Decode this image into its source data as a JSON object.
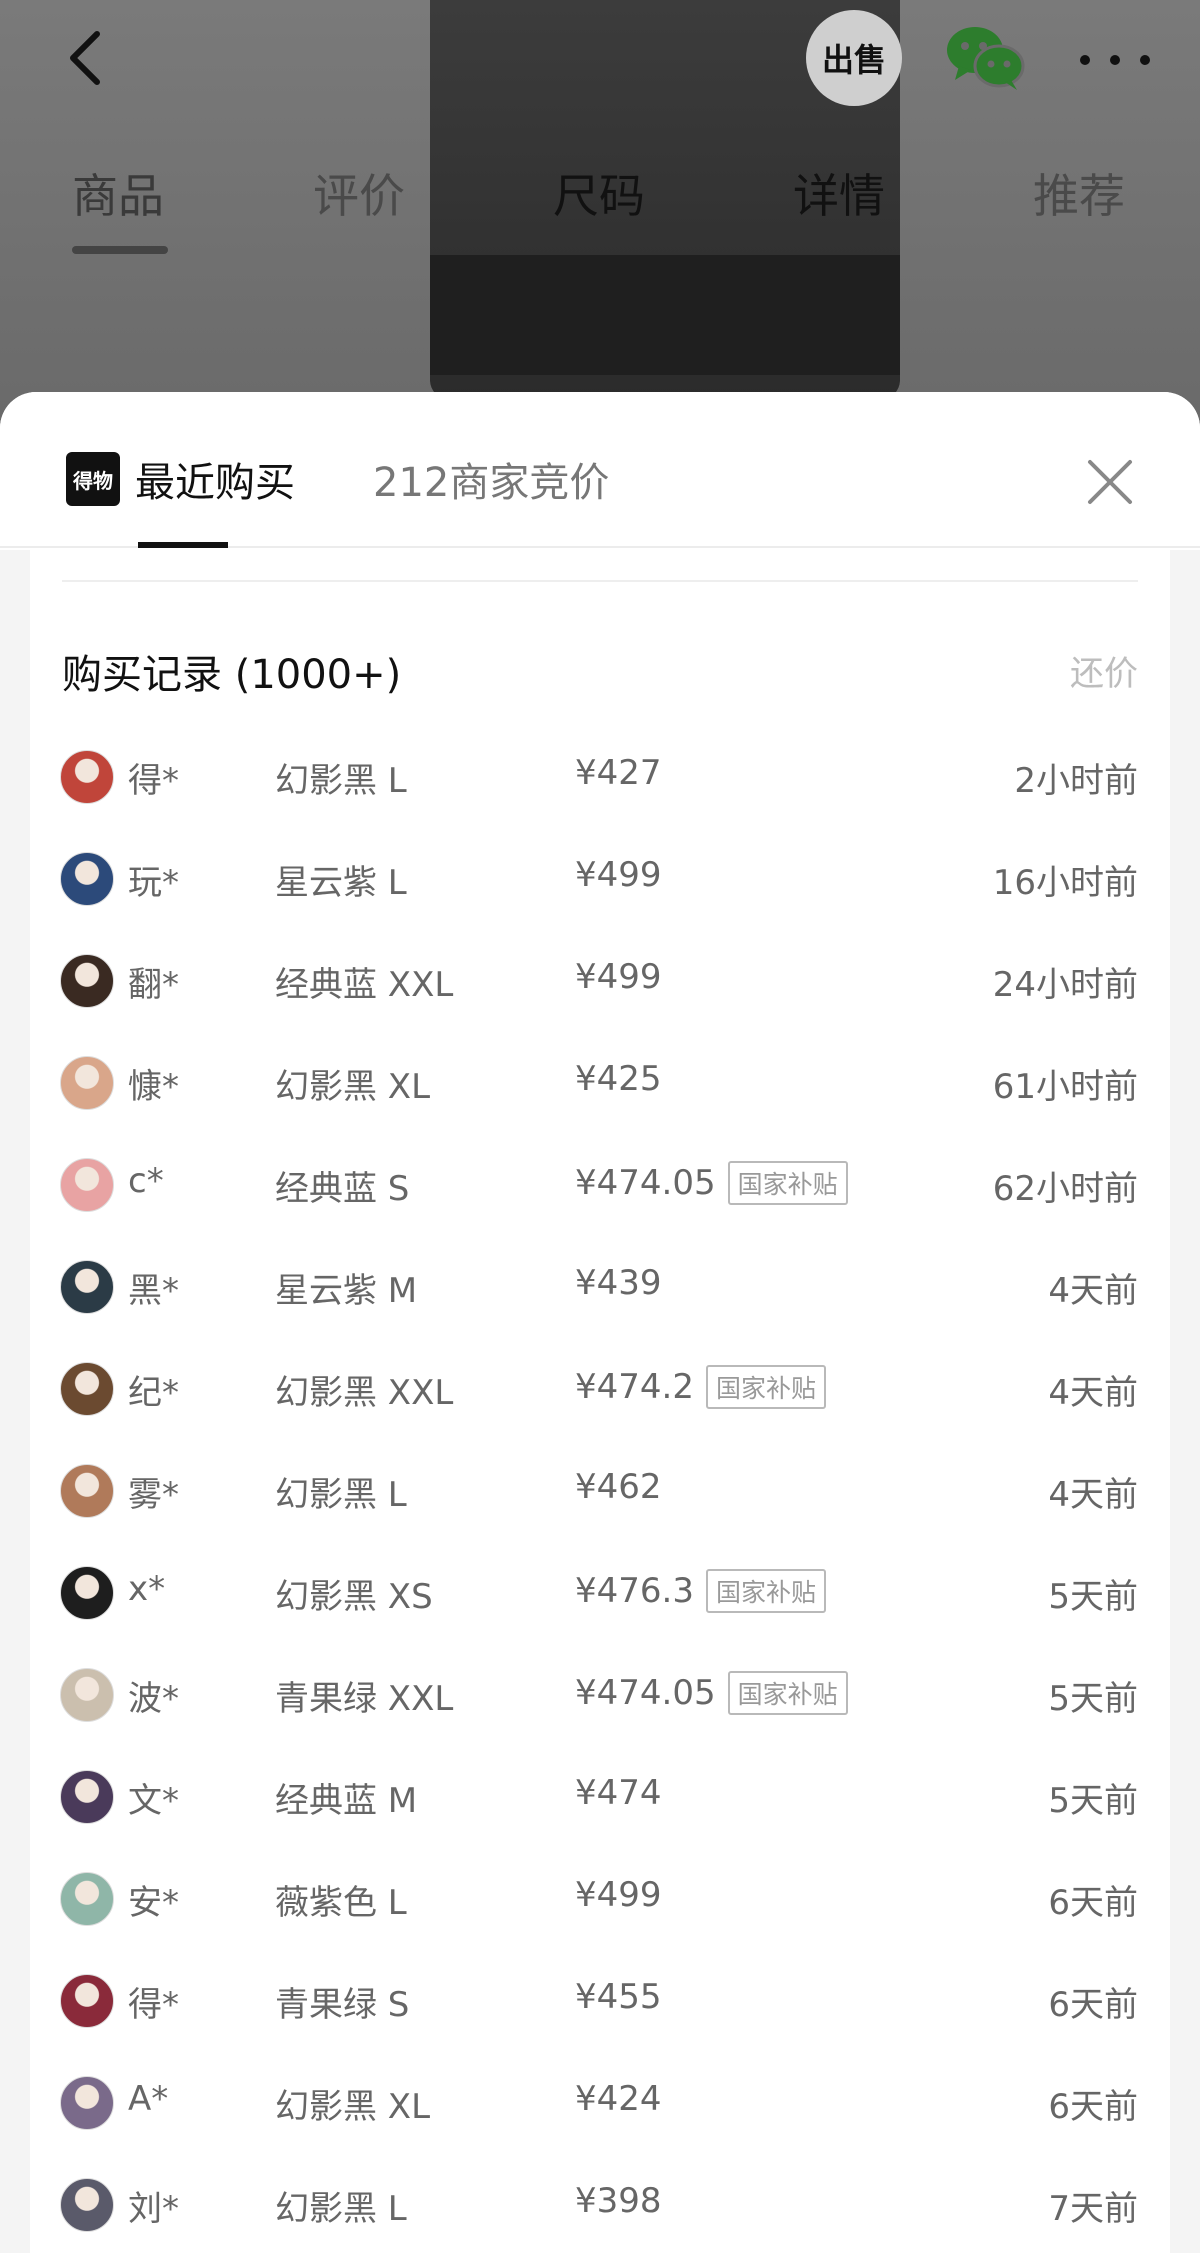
{
  "topbar": {
    "sell_label": "出售",
    "icons": {
      "back": "back-chevron-icon",
      "wechat": "wechat-icon",
      "more": "more-dots-icon"
    }
  },
  "nav": {
    "tabs": [
      "商品",
      "评价",
      "尺码",
      "详情",
      "推荐"
    ],
    "active_index": 0
  },
  "sheet": {
    "brand_logo": "得物",
    "tabs": {
      "recent": "最近购买",
      "merchant": "212商家竞价"
    },
    "records_title": "购买记录 (1000+)",
    "counter_offer": "还价",
    "colors": {
      "accent": "#111111",
      "text_secondary": "#666666",
      "muted": "#bdbdbd"
    }
  },
  "records": [
    {
      "user": "得*",
      "spec": "幻影黑 L",
      "price": "¥427",
      "badge": "",
      "time": "2小时前",
      "avatar_color": "#c0453a"
    },
    {
      "user": "玩*",
      "spec": "星云紫 L",
      "price": "¥499",
      "badge": "",
      "time": "16小时前",
      "avatar_color": "#2c4a7a"
    },
    {
      "user": "翻*",
      "spec": "经典蓝 XXL",
      "price": "¥499",
      "badge": "",
      "time": "24小时前",
      "avatar_color": "#3a2a22"
    },
    {
      "user": "慷*",
      "spec": "幻影黑 XL",
      "price": "¥425",
      "badge": "",
      "time": "61小时前",
      "avatar_color": "#d9a68a"
    },
    {
      "user": "c*",
      "spec": "经典蓝 S",
      "price": "¥474.05",
      "badge": "国家补贴",
      "time": "62小时前",
      "avatar_color": "#e8a3a3"
    },
    {
      "user": "黑*",
      "spec": "星云紫 M",
      "price": "¥439",
      "badge": "",
      "time": "4天前",
      "avatar_color": "#2b3b46"
    },
    {
      "user": "纪*",
      "spec": "幻影黑 XXL",
      "price": "¥474.2",
      "badge": "国家补贴",
      "time": "4天前",
      "avatar_color": "#6b4a30"
    },
    {
      "user": "雾*",
      "spec": "幻影黑 L",
      "price": "¥462",
      "badge": "",
      "time": "4天前",
      "avatar_color": "#b07a5a"
    },
    {
      "user": "x*",
      "spec": "幻影黑 XS",
      "price": "¥476.3",
      "badge": "国家补贴",
      "time": "5天前",
      "avatar_color": "#1e1e1e"
    },
    {
      "user": "波*",
      "spec": "青果绿 XXL",
      "price": "¥474.05",
      "badge": "国家补贴",
      "time": "5天前",
      "avatar_color": "#cbbfae"
    },
    {
      "user": "文*",
      "spec": "经典蓝 M",
      "price": "¥474",
      "badge": "",
      "time": "5天前",
      "avatar_color": "#4a3a5a"
    },
    {
      "user": "安*",
      "spec": "薇紫色 L",
      "price": "¥499",
      "badge": "",
      "time": "6天前",
      "avatar_color": "#8fb6a8"
    },
    {
      "user": "得*",
      "spec": "青果绿 S",
      "price": "¥455",
      "badge": "",
      "time": "6天前",
      "avatar_color": "#8a2a3a"
    },
    {
      "user": "A*",
      "spec": "幻影黑 XL",
      "price": "¥424",
      "badge": "",
      "time": "6天前",
      "avatar_color": "#7a6a8a"
    },
    {
      "user": "刘*",
      "spec": "幻影黑 L",
      "price": "¥398",
      "badge": "",
      "time": "7天前",
      "avatar_color": "#5a5a6a"
    }
  ]
}
